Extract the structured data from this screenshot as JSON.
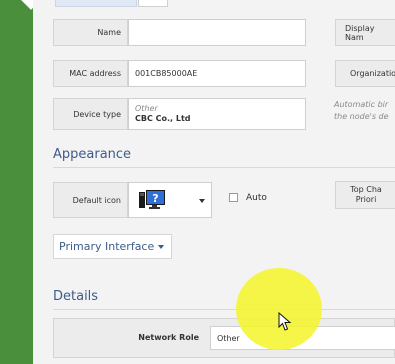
{
  "form": {
    "name_label": "Name",
    "name_value": "",
    "display_name_label": "Display Nam",
    "mac_label": "MAC address",
    "mac_value": "001CB85000AE",
    "organization_label": "Organizatio",
    "device_type_label": "Device type",
    "device_type_category": "Other",
    "device_type_vendor": "CBC Co., Ltd",
    "auto_note_line1": "Automatic bir",
    "auto_note_line2": "the node's de"
  },
  "appearance": {
    "title": "Appearance",
    "default_icon_label": "Default icon",
    "auto_label": "Auto",
    "auto_checked": false,
    "top_change_label_line1": "Top Cha",
    "top_change_label_line2": "Priori",
    "primary_interface_label": "Primary Interface"
  },
  "details": {
    "title": "Details",
    "network_role_label": "Network Role",
    "network_role_value": "Other"
  },
  "icons": {
    "default_icon": "monitor-question-icon",
    "dropdown": "chevron-down-icon",
    "cursor": "mouse-pointer-icon"
  },
  "colors": {
    "sidebar": "#4a8f3c",
    "section_title": "#3d5c8a",
    "highlight": "#f5f530"
  }
}
